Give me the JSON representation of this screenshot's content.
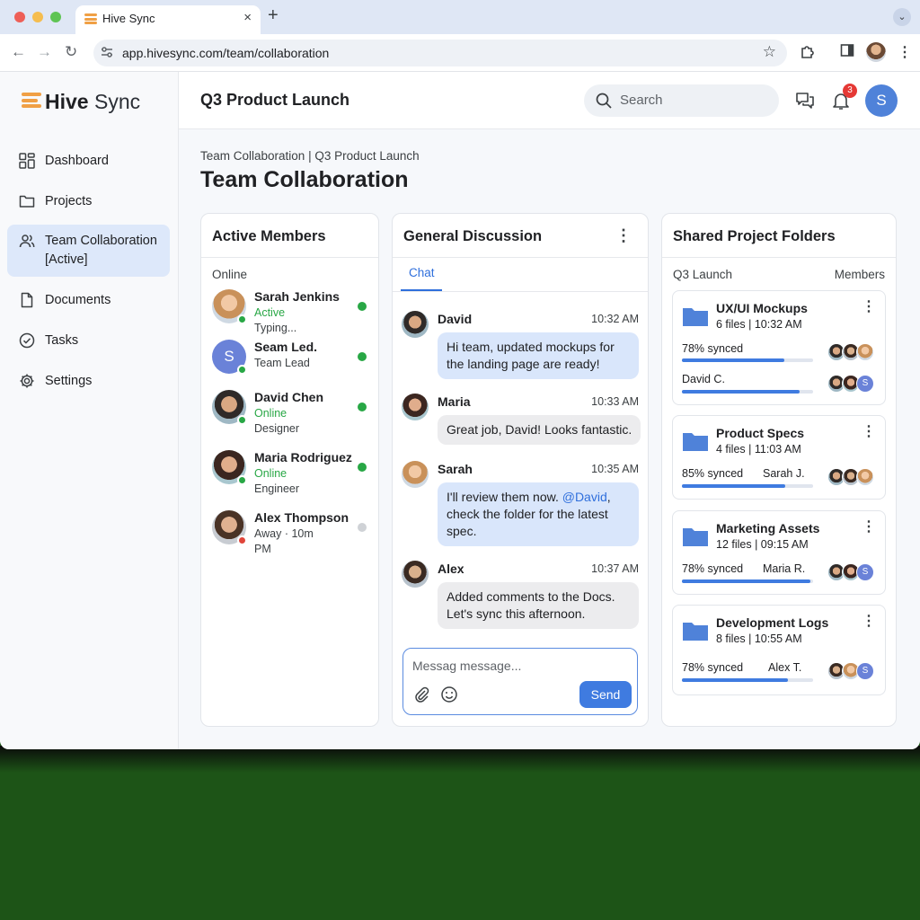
{
  "browser": {
    "tab_title": "Hive Sync",
    "tab_close": "×",
    "new_tab": "+",
    "url": "app.hivesync.com/team/collaboration"
  },
  "app": {
    "logo_bold": "Hive",
    "logo_rest": " Sync",
    "accent": "#3f7be0",
    "brand": "#f0a045"
  },
  "sidebar": {
    "items": [
      {
        "label": "Dashboard",
        "icon": "grid-icon"
      },
      {
        "label": "Projects",
        "icon": "folder-icon"
      },
      {
        "label": "Team Collaboration",
        "sub": "[Active]",
        "icon": "users-icon",
        "active": true
      },
      {
        "label": "Documents",
        "icon": "document-icon"
      },
      {
        "label": "Tasks",
        "icon": "check-circle-icon"
      },
      {
        "label": "Settings",
        "icon": "gear-icon"
      }
    ]
  },
  "header": {
    "title": "Q3 Product Launch",
    "search_placeholder": "Search",
    "notification_count": "3",
    "avatar_initial": "S"
  },
  "page": {
    "breadcrumb": "Team Collaboration | Q3 Product Launch",
    "title": "Team Collaboration"
  },
  "members": {
    "title": "Active Members",
    "group": "Online",
    "list": [
      {
        "name": "Sarah Jenkins",
        "line1": "Active",
        "line2": "Typing...",
        "presence": "online"
      },
      {
        "name": "Seam Led.",
        "line1": "Team Lead",
        "presence": "online",
        "initial": "S"
      },
      {
        "name": "David Chen",
        "line1": "Online",
        "line2": "Designer",
        "presence": "online"
      },
      {
        "name": "Maria Rodriguez",
        "line1": "Online",
        "line2": "Engineer",
        "presence": "online"
      },
      {
        "name": "Alex Thompson",
        "line1": "Away · 10m",
        "line2": "PM",
        "presence": "away"
      }
    ]
  },
  "chat": {
    "title": "General Discussion",
    "tab": "Chat",
    "messages": [
      {
        "author": "David",
        "time": "10:32 AM",
        "text": "Hi team, updated mockups for the landing page are ready!",
        "style": "blue"
      },
      {
        "author": "Maria",
        "time": "10:33 AM",
        "text": "Great job, David! Looks fantastic.",
        "style": "grey"
      },
      {
        "author": "Sarah",
        "time": "10:35 AM",
        "text_before": "I'll review them now. ",
        "mention": "@David",
        "text_after": ", check the folder for the latest spec.",
        "style": "blue"
      },
      {
        "author": "Alex",
        "time": "10:37 AM",
        "text": "Added comments to the Docs. Let's sync this afternoon.",
        "style": "grey"
      }
    ],
    "composer_placeholder": "Messag message...",
    "send_label": "Send"
  },
  "folders": {
    "title": "Shared Project Folders",
    "sub_left": "Q3 Launch",
    "sub_right": "Members",
    "list": [
      {
        "name": "UX/UI Mockups",
        "meta": "6 files | 10:32 AM",
        "rows": [
          {
            "label": "78% synced",
            "progress": 0.78
          },
          {
            "label": "David C.",
            "progress": 0.9,
            "stack_initial": "S"
          }
        ]
      },
      {
        "name": "Product Specs",
        "meta": "4 files | 11:03 AM",
        "sync": "85% synced",
        "who": "Sarah J.",
        "progress": 0.79
      },
      {
        "name": "Marketing Assets",
        "meta": "12 files | 09:15 AM",
        "sync": "78% synced",
        "who": "Maria R.",
        "progress": 0.98,
        "stack_initial": "S"
      },
      {
        "name": "Development Logs",
        "meta": "8 files | 10:55 AM",
        "sync": "78% synced",
        "who": "Alex T.",
        "progress": 0.81,
        "stack_initial": "S"
      }
    ]
  }
}
